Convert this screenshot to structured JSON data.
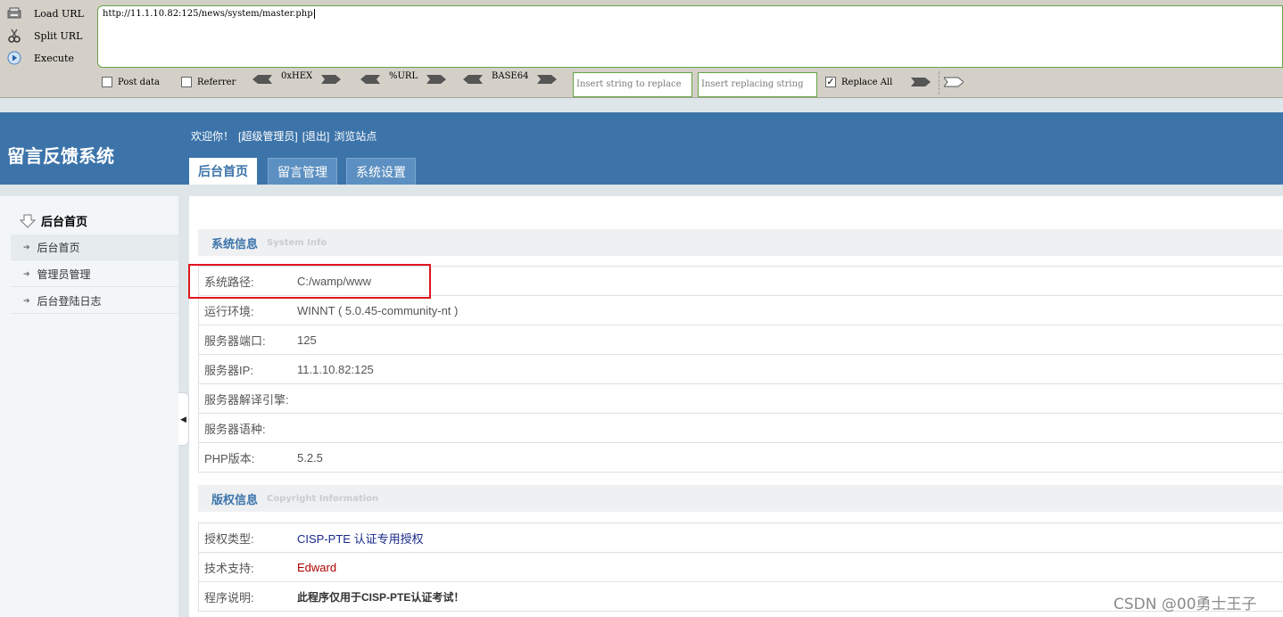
{
  "hackbar": {
    "commands": [
      {
        "label": "Load URL",
        "icon": "load-url-icon"
      },
      {
        "label": "Split URL",
        "icon": "split-url-icon"
      },
      {
        "label": "Execute",
        "icon": "execute-icon"
      }
    ],
    "url_value": "http://11.1.10.82:125/news/system/master.php",
    "post_data_label": "Post data",
    "post_data_checked": false,
    "referrer_label": "Referrer",
    "referrer_checked": false,
    "hex_label": "0xHEX",
    "url_label": "%URL",
    "base64_label": "BASE64",
    "insert_string_placeholder": "Insert string to replace",
    "insert_replacing_placeholder": "Insert replacing string",
    "replace_all_label": "Replace All",
    "replace_all_checked": true,
    "accent_color": "#66a346"
  },
  "header": {
    "site_title": "留言反馈系统",
    "welcome": "欢迎你！",
    "role": "[超级管理员]",
    "logout": "[退出]",
    "browse": "浏览站点",
    "tabs": [
      {
        "label": "后台首页",
        "active": true
      },
      {
        "label": "留言管理",
        "active": false
      },
      {
        "label": "系统设置",
        "active": false
      }
    ],
    "brand_color": "#3c74aa"
  },
  "sidebar": {
    "heading": "后台首页",
    "items": [
      {
        "label": "后台首页",
        "active": true
      },
      {
        "label": "管理员管理",
        "active": false
      },
      {
        "label": "后台登陆日志",
        "active": false
      }
    ]
  },
  "system_info": {
    "title": "系统信息",
    "title_en": "System Info",
    "rows": [
      {
        "key": "系统路径:",
        "value": "C:/wamp/www"
      },
      {
        "key": "运行环境:",
        "value": "WINNT ( 5.0.45-community-nt )"
      },
      {
        "key": "服务器端口:",
        "value": "125"
      },
      {
        "key": "服务器IP:",
        "value": "11.1.10.82:125"
      },
      {
        "key": "服务器解译引擎:",
        "value": ""
      },
      {
        "key": "服务器语种:",
        "value": ""
      },
      {
        "key": "PHP版本:",
        "value": "5.2.5"
      }
    ]
  },
  "copyright": {
    "title": "版权信息",
    "title_en": "Copyright Information",
    "rows": [
      {
        "key": "授权类型:",
        "value": "CISP-PTE 认证专用授权"
      },
      {
        "key": "技术支持:",
        "value": "Edward"
      },
      {
        "key": "程序说明:",
        "value": "此程序仅用于CISP-PTE认证考试！"
      }
    ]
  },
  "watermark": "CSDN @00勇士王子"
}
